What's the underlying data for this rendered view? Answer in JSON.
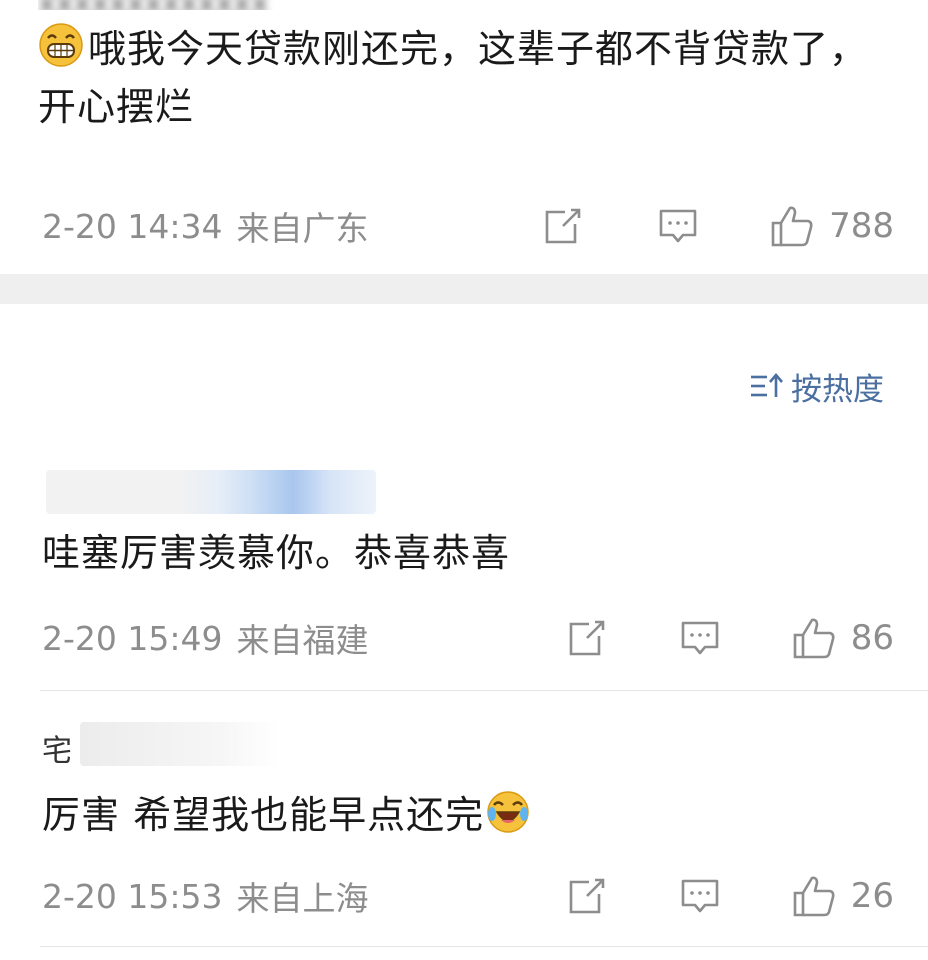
{
  "comments": [
    {
      "content": "哦我今天贷款刚还完，这辈子都不背贷款了，开心摆烂",
      "time": "2-20 14:34",
      "location": "来自广东",
      "likes": "788"
    },
    {
      "content": "哇塞厉害羡慕你。恭喜恭喜",
      "time": "2-20 15:49",
      "location": "来自福建",
      "likes": "86"
    },
    {
      "username_visible": "宅",
      "content": "厉害 希望我也能早点还完",
      "time": "2-20 15:53",
      "location": "来自上海",
      "likes": "26"
    }
  ],
  "sort": {
    "label": "按热度"
  },
  "icons": {
    "repost": "repost-icon",
    "comment": "comment-icon",
    "like": "thumbs-up-icon",
    "sort": "sort-icon",
    "emoji1": "grinning-emoji-icon",
    "emoji2": "laughing-crying-emoji-icon"
  },
  "colors": {
    "meta": "#8d8d8d",
    "sort": "#4a6fa0",
    "gap": "#efefef"
  }
}
